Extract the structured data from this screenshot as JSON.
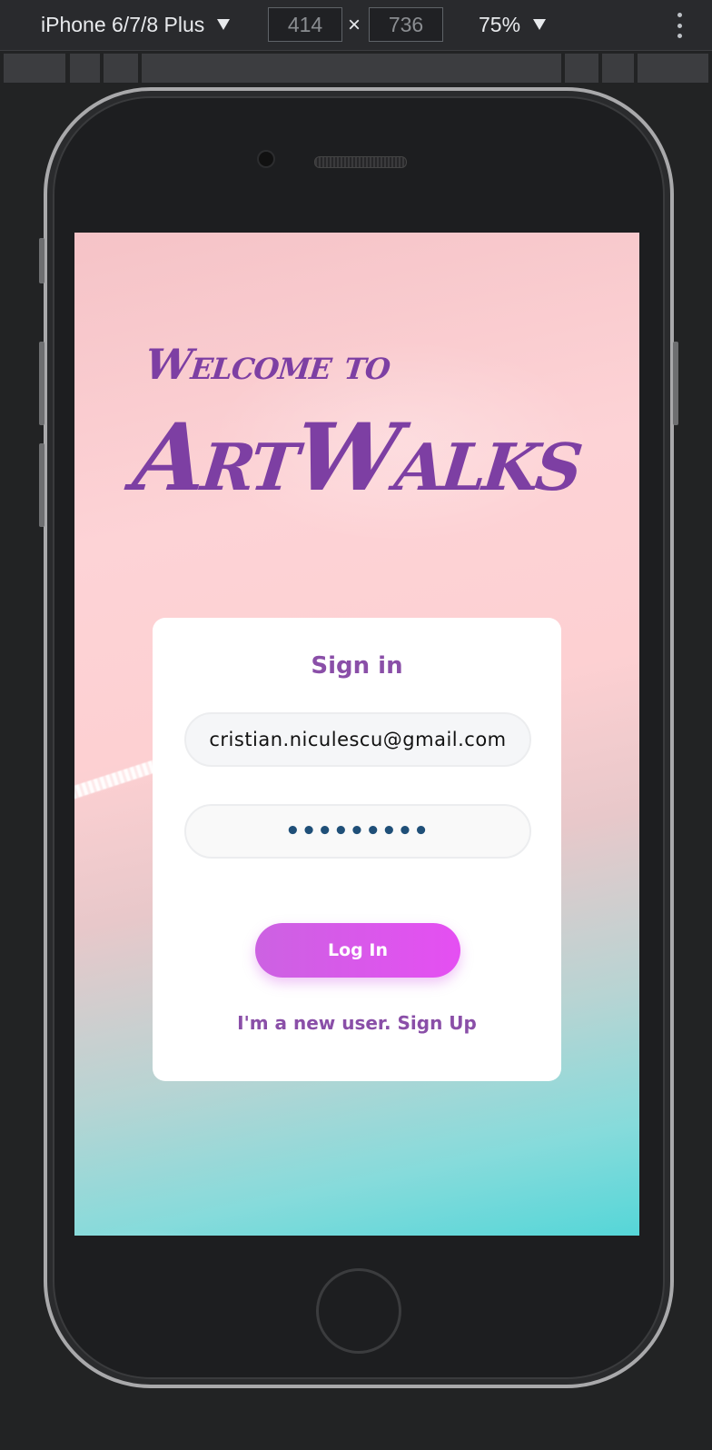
{
  "devtools": {
    "device_label": "iPhone 6/7/8 Plus",
    "device_caret": "chevron-down-icon",
    "width_value": "414",
    "times_symbol": "×",
    "height_value": "736",
    "zoom_label": "75%",
    "menu_icon": "kebab-menu-icon"
  },
  "app": {
    "welcome": "Welcome to",
    "title": "ArtWalks",
    "signin": {
      "heading": "Sign in",
      "email_value": "cristian.niculescu@gmail.com",
      "password_value": "•••••••••",
      "login_label": "Log In",
      "signup_link": "I'm a new user. Sign Up"
    }
  },
  "colors": {
    "brand_purple": "#7d3fa3",
    "button_gradient_start": "#cc62e2",
    "button_gradient_end": "#e54ff2",
    "devtools_bg": "#292a2d"
  }
}
